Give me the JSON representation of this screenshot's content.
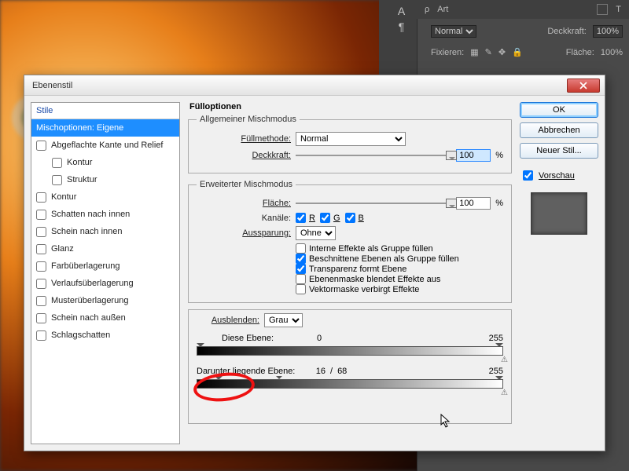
{
  "ps_panel": {
    "art_label": "Art",
    "blend_label": "Normal",
    "opacity_label": "Deckkraft:",
    "opacity_value": "100%",
    "lock_label": "Fixieren:",
    "fill_label": "Fläche:",
    "fill_value": "100%"
  },
  "dialog": {
    "title": "Ebenenstil",
    "close": "x"
  },
  "left": {
    "header": "Stile",
    "items": [
      {
        "label": "Mischoptionen: Eigene",
        "selected": true
      },
      {
        "label": "Abgeflachte Kante und Relief"
      },
      {
        "label": "Kontur",
        "indent": true
      },
      {
        "label": "Struktur",
        "indent": true
      },
      {
        "label": "Kontur"
      },
      {
        "label": "Schatten nach innen"
      },
      {
        "label": "Schein nach innen"
      },
      {
        "label": "Glanz"
      },
      {
        "label": "Farbüberlagerung"
      },
      {
        "label": "Verlaufsüberlagerung"
      },
      {
        "label": "Musterüberlagerung"
      },
      {
        "label": "Schein nach außen"
      },
      {
        "label": "Schlagschatten"
      }
    ]
  },
  "fill_opts": {
    "title": "Fülloptionen",
    "group_general": "Allgemeiner Mischmodus",
    "blend_label": "Füllmethode:",
    "blend_value": "Normal",
    "opacity_label": "Deckkraft:",
    "opacity_value": "100",
    "pct": "%",
    "group_adv": "Erweiterter Mischmodus",
    "fill_label": "Fläche:",
    "fill_value": "100",
    "channels_label": "Kanäle:",
    "ch_r": "R",
    "ch_g": "G",
    "ch_b": "B",
    "knockout_label": "Aussparung:",
    "knockout_value": "Ohne",
    "check1": "Interne Effekte als Gruppe füllen",
    "check2": "Beschnittene Ebenen als Gruppe füllen",
    "check3": "Transparenz formt Ebene",
    "check4": "Ebenenmaske blendet Effekte aus",
    "check5": "Vektormaske verbirgt Effekte",
    "blendif_label": "Ausblenden:",
    "blendif_value": "Grau",
    "this_layer": "Diese Ebene:",
    "this_black": "0",
    "this_white": "255",
    "under_layer": "Darunter liegende Ebene:",
    "under_black": "16",
    "under_black2": "68",
    "under_sep": "/",
    "under_white": "255"
  },
  "right": {
    "ok": "OK",
    "cancel": "Abbrechen",
    "newstyle": "Neuer Stil...",
    "preview": "Vorschau"
  }
}
